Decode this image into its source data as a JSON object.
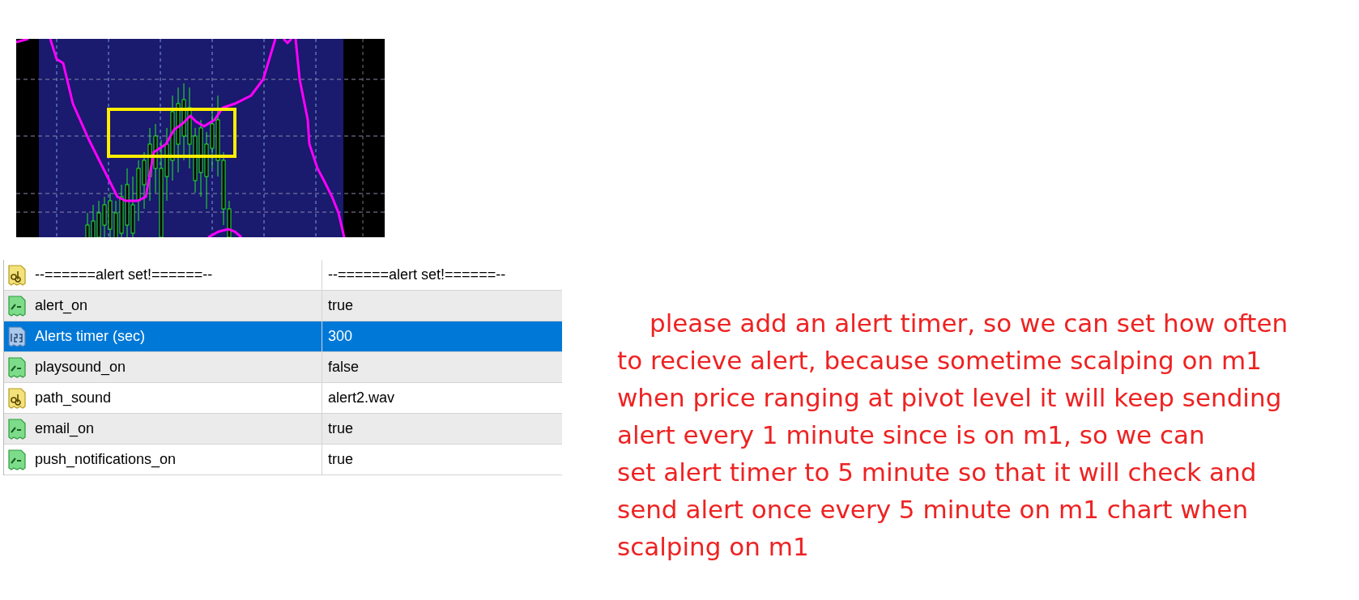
{
  "parameters": [
    {
      "kind": "text",
      "name": "--======alert set!======--",
      "value": "--======alert set!======--",
      "selected": false
    },
    {
      "kind": "bool",
      "name": "alert_on",
      "value": "true",
      "selected": false
    },
    {
      "kind": "number",
      "name": "Alerts timer (sec)",
      "value": "300",
      "selected": true
    },
    {
      "kind": "bool",
      "name": "playsound_on",
      "value": "false",
      "selected": false
    },
    {
      "kind": "text",
      "name": "path_sound",
      "value": "alert2.wav",
      "selected": false
    },
    {
      "kind": "bool",
      "name": "email_on",
      "value": "true",
      "selected": false
    },
    {
      "kind": "bool",
      "name": "push_notifications_on",
      "value": "true",
      "selected": false
    }
  ],
  "note": {
    "lines": [
      "please add an alert timer, so we can set how often",
      "to recieve alert, because sometime scalping on m1",
      "when price ranging at pivot level it will keep sending",
      "alert every 1 minute since is on m1, so we can",
      "set alert timer to 5 minute so that it will check and",
      "send alert once every 5 minute on m1 chart when",
      "scalping on m1"
    ]
  }
}
